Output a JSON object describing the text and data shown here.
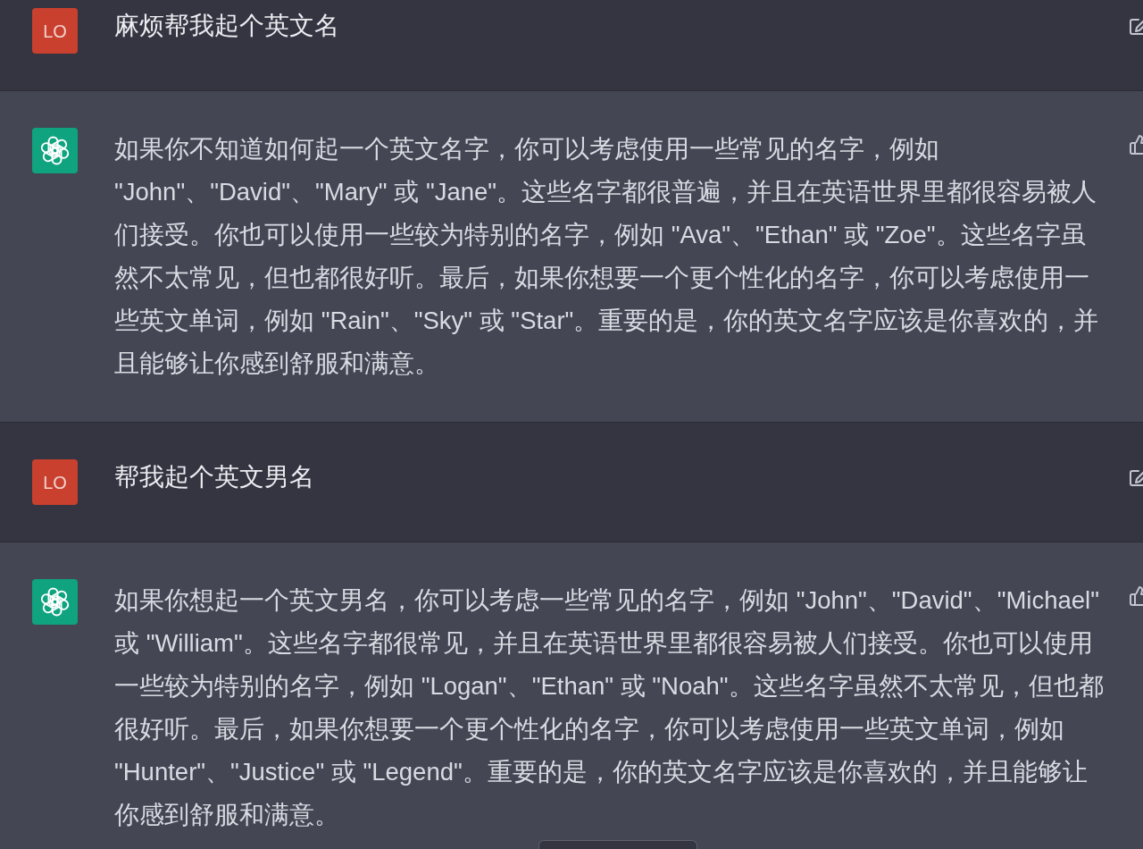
{
  "messages": [
    {
      "kind": "user",
      "avatar": "LO",
      "text": "麻烦帮我起个英文名"
    },
    {
      "kind": "assistant",
      "text": "如果你不知道如何起一个英文名字，你可以考虑使用一些常见的名字，例如 \"John\"、\"David\"、\"Mary\" 或 \"Jane\"。这些名字都很普遍，并且在英语世界里都很容易被人们接受。你也可以使用一些较为特别的名字，例如 \"Ava\"、\"Ethan\" 或 \"Zoe\"。这些名字虽然不太常见，但也都很好听。最后，如果你想要一个更个性化的名字，你可以考虑使用一些英文单词，例如 \"Rain\"、\"Sky\" 或 \"Star\"。重要的是，你的英文名字应该是你喜欢的，并且能够让你感到舒服和满意。"
    },
    {
      "kind": "user",
      "avatar": "LO",
      "text": "帮我起个英文男名"
    },
    {
      "kind": "assistant",
      "text": "如果你想起一个英文男名，你可以考虑一些常见的名字，例如 \"John\"、\"David\"、\"Michael\" 或 \"William\"。这些名字都很常见，并且在英语世界里都很容易被人们接受。你也可以使用一些较为特别的名字，例如 \"Logan\"、\"Ethan\" 或 \"Noah\"。这些名字虽然不太常见，但也都很好听。最后，如果你想要一个更个性化的名字，你可以考虑使用一些英文单词，例如 \"Hunter\"、\"Justice\" 或 \"Legend\"。重要的是，你的英文名字应该是你喜欢的，并且能够让你感到舒服和满意。"
    }
  ]
}
